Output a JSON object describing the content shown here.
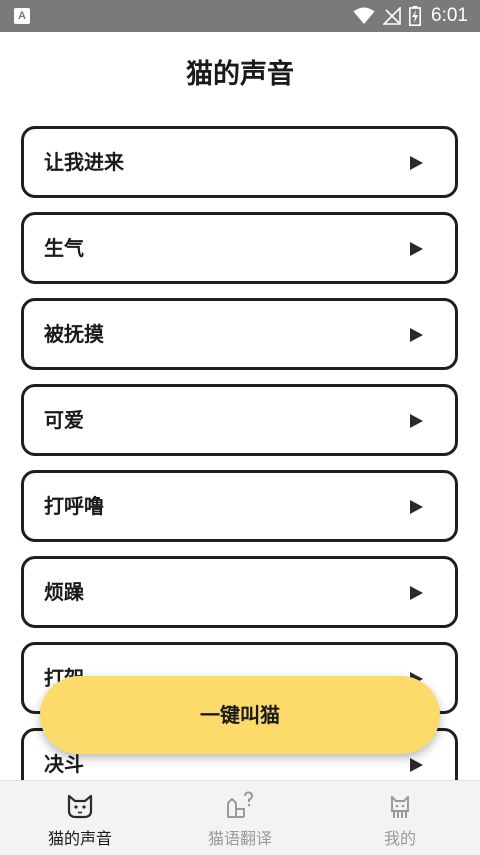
{
  "status_bar": {
    "app_badge": "A",
    "time": "6:01",
    "icons": [
      "wifi-icon",
      "no-signal-icon",
      "battery-charging-icon"
    ]
  },
  "page": {
    "title": "猫的声音"
  },
  "sounds": [
    {
      "label": "让我进来",
      "icon": "play-icon"
    },
    {
      "label": "生气",
      "icon": "play-icon"
    },
    {
      "label": "被抚摸",
      "icon": "play-icon"
    },
    {
      "label": "可爱",
      "icon": "play-icon"
    },
    {
      "label": "打呼噜",
      "icon": "play-icon"
    },
    {
      "label": "烦躁",
      "icon": "play-icon"
    },
    {
      "label": "打架",
      "icon": "play-icon"
    },
    {
      "label": "决斗",
      "icon": "play-icon"
    }
  ],
  "action_button": {
    "label": "一键叫猫",
    "color": "#fddb6b"
  },
  "bottom_nav": {
    "tabs": [
      {
        "label": "猫的声音",
        "icon": "cat-face-icon",
        "active": true
      },
      {
        "label": "猫语翻译",
        "icon": "cat-question-icon",
        "active": false
      },
      {
        "label": "我的",
        "icon": "cat-profile-icon",
        "active": false
      }
    ]
  }
}
